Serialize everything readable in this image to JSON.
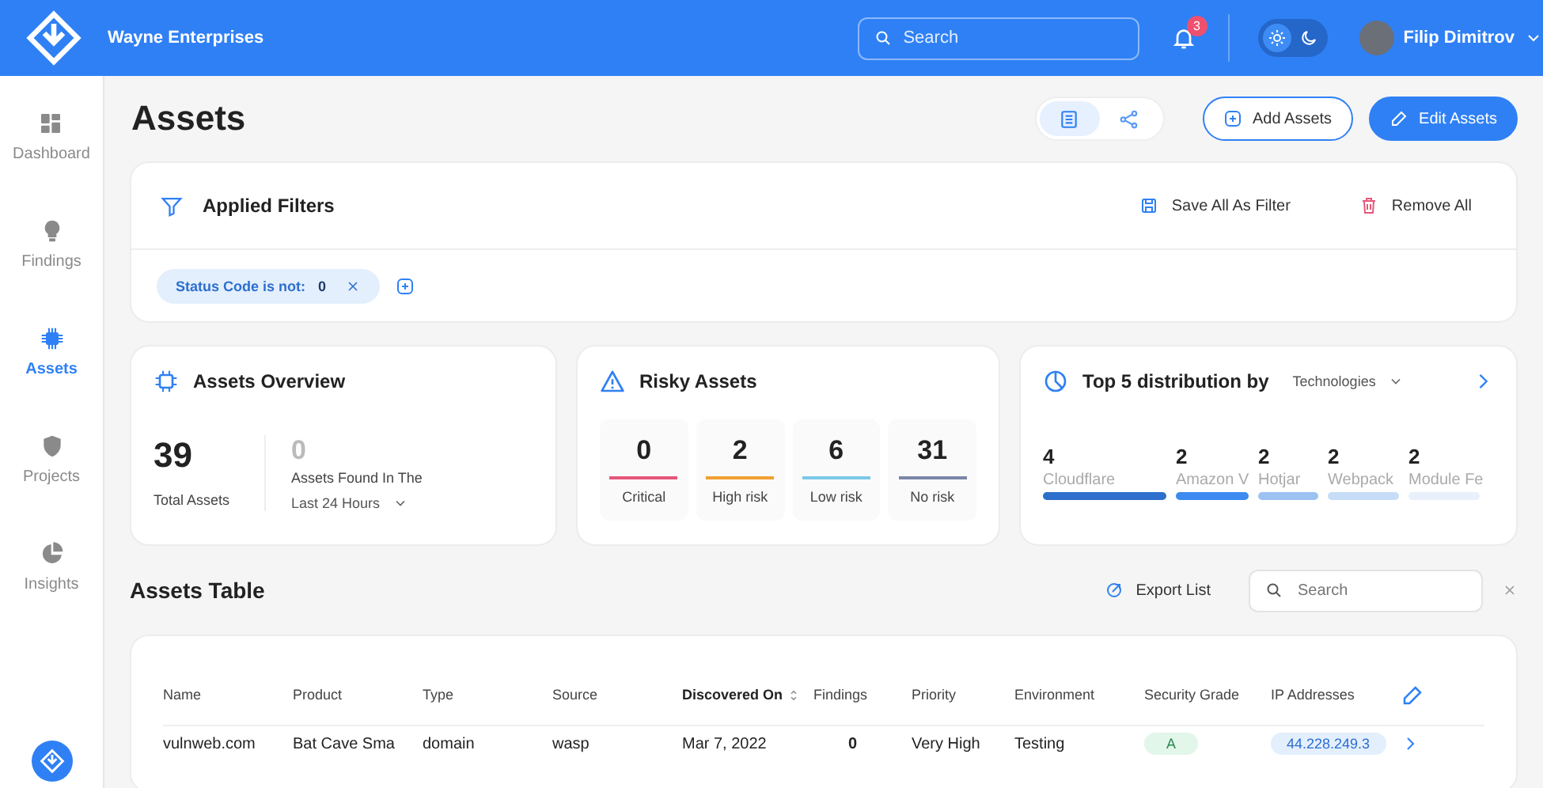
{
  "header": {
    "company": "Wayne Enterprises",
    "search": {
      "placeholder": "Search"
    },
    "notifications": "3",
    "theme_toggle": [
      {
        "kind": "light",
        "selected": true
      },
      {
        "kind": "dark",
        "selected": false
      }
    ],
    "user": "Filip Dimitrov"
  },
  "sidebar": {
    "items": [
      {
        "kind": "dashboard",
        "label": "Dashboard",
        "selected": false
      },
      {
        "kind": "findings",
        "label": "Findings",
        "selected": false
      },
      {
        "kind": "assets",
        "label": "Assets",
        "selected": true
      },
      {
        "kind": "projects",
        "label": "Projects",
        "selected": false
      },
      {
        "kind": "insights",
        "label": "Insights",
        "selected": false
      }
    ]
  },
  "page": {
    "title": "Assets",
    "view_toggle": [
      {
        "kind": "list",
        "selected": true
      },
      {
        "kind": "graph",
        "selected": false
      }
    ],
    "buttons": [
      {
        "kind": "outline",
        "label": "Add Assets"
      },
      {
        "kind": "primary",
        "label": "Edit Assets"
      }
    ]
  },
  "filters": {
    "title": "Applied Filters",
    "actions": [
      {
        "kind": "save",
        "label": "Save All As Filter"
      },
      {
        "kind": "remove",
        "label": "Remove All"
      }
    ],
    "chips": [
      {
        "label": "Status Code is not:",
        "value": "0"
      }
    ]
  },
  "overview": {
    "title": "Assets Overview",
    "total": "39",
    "total_label": "Total Assets",
    "recent": "0",
    "recent_label": "Assets Found In The",
    "period": "Last 24 Hours"
  },
  "risky": {
    "title": "Risky Assets",
    "items": [
      {
        "value": "0",
        "label": "Critical",
        "color": "#e5577a"
      },
      {
        "value": "2",
        "label": "High risk",
        "color": "#f0a030"
      },
      {
        "value": "6",
        "label": "Low risk",
        "color": "#7cc8e8"
      },
      {
        "value": "31",
        "label": "No risk",
        "color": "#7b86a8"
      }
    ]
  },
  "distribution": {
    "title": "Top 5 distribution by",
    "dimension": "Technologies",
    "items": [
      {
        "value": "4",
        "label": "Cloudflare",
        "color": "#2d6fcc"
      },
      {
        "value": "2",
        "label": "Amazon V",
        "color": "#3d8af0"
      },
      {
        "value": "2",
        "label": "Hotjar",
        "color": "#9cc2f2"
      },
      {
        "value": "2",
        "label": "Webpack",
        "color": "#c7dcf6"
      },
      {
        "value": "2",
        "label": "Module Fe",
        "color": "#e8f0fb"
      }
    ]
  },
  "table": {
    "title": "Assets Table",
    "export": "Export List",
    "search": {
      "placeholder": "Search"
    },
    "columns": [
      {
        "label": "Name",
        "sorted": false
      },
      {
        "label": "Product",
        "sorted": false
      },
      {
        "label": "Type",
        "sorted": false
      },
      {
        "label": "Source",
        "sorted": false
      },
      {
        "label": "Discovered On",
        "sorted": true
      },
      {
        "label": "Findings",
        "sorted": false
      },
      {
        "label": "Priority",
        "sorted": false
      },
      {
        "label": "Environment",
        "sorted": false
      },
      {
        "label": "Security Grade",
        "sorted": false
      },
      {
        "label": "IP Addresses",
        "sorted": false
      }
    ],
    "rows": [
      {
        "cells": [
          "vulnweb.com",
          "Bat Cave Sma",
          "domain",
          "wasp",
          "Mar 7, 2022",
          "0",
          "Very High",
          "Testing",
          "A",
          "44.228.249.3"
        ]
      }
    ]
  }
}
